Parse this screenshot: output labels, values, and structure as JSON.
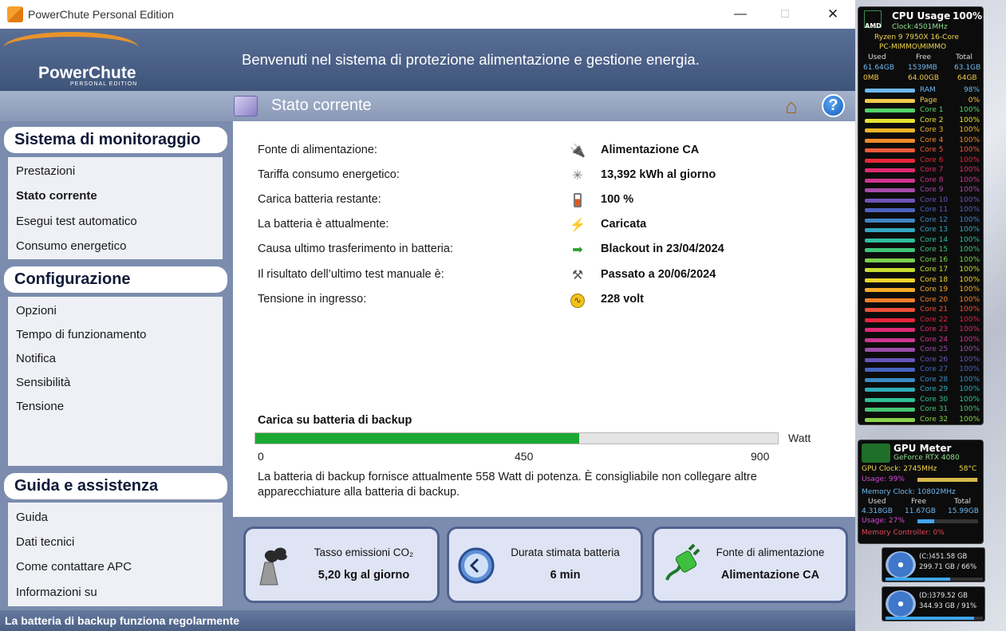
{
  "window": {
    "title": "PowerChute Personal Edition",
    "minimize": "—",
    "maximize": "☐",
    "close": "✕"
  },
  "header": {
    "logo": "PowerChute",
    "logo_sub": "PERSONAL EDITION",
    "welcome": "Benvenuti nel sistema di protezione alimentazione e gestione energia."
  },
  "page": {
    "title": "Stato corrente",
    "home_icon": "home-icon",
    "help_icon": "help-icon"
  },
  "sidebar": {
    "sections": [
      {
        "title": "Sistema di monitoraggio",
        "items": [
          "Prestazioni",
          "Stato corrente",
          "Esegui test automatico",
          "Consumo energetico"
        ]
      },
      {
        "title": "Configurazione",
        "items": [
          "Opzioni",
          "Tempo di funzionamento",
          "Notifica",
          "Sensibilità",
          "Tensione"
        ]
      },
      {
        "title": "Guida e assistenza",
        "items": [
          "Guida",
          "Dati tecnici",
          "Come contattare APC",
          "Informazioni su"
        ]
      }
    ],
    "active_item": "Stato corrente"
  },
  "status": {
    "rows": [
      {
        "label": "Fonte di alimentazione:",
        "value": "Alimentazione CA",
        "icon": "plug-icon"
      },
      {
        "label": "Tariffa consumo energetico:",
        "value": "13,392 kWh al giorno",
        "icon": "power-tower-icon"
      },
      {
        "label": "Carica batteria restante:",
        "value": "100 %",
        "icon": "battery-icon"
      },
      {
        "label": "La batteria è attualmente:",
        "value": "Caricata",
        "icon": "lightning-icon"
      },
      {
        "label": "Causa ultimo trasferimento in batteria:",
        "value": "Blackout in 23/04/2024",
        "icon": "transfer-icon"
      },
      {
        "label": "Il risultato dell’ultimo test manuale è:",
        "value": "Passato a 20/06/2024",
        "icon": "wrench-icon"
      },
      {
        "label": "Tensione in ingresso:",
        "value": "228 volt",
        "icon": "voltage-icon"
      }
    ]
  },
  "load": {
    "title": "Carica su batteria di backup",
    "unit": "Watt",
    "value": 558,
    "max": 900,
    "ticks": [
      "0",
      "450",
      "900"
    ],
    "note": "La batteria di backup fornisce attualmente 558 Watt di potenza. È consigliabile non collegare altre apparecchiature alla batteria di backup."
  },
  "cards": [
    {
      "label": "Tasso emissioni CO₂",
      "value": "5,20 kg al giorno",
      "icon": "factory-smoke-icon"
    },
    {
      "label": "Durata stimata batteria",
      "value": "6 min",
      "icon": "clock-icon"
    },
    {
      "label": "Fonte di alimentazione",
      "value": "Alimentazione CA",
      "icon": "plug-icon"
    }
  ],
  "statusbar": {
    "text": "La batteria di backup funziona regolarmente"
  },
  "cpu_meter": {
    "title": "CPU Usage",
    "usage": "100%",
    "brand": "AMD",
    "clock": "Clock:4501MHz",
    "model": "Ryzen 9 7950X 16-Core",
    "host": "PC-MIMMO\\MIMMO",
    "mem_headers": [
      "Used",
      "Free",
      "Total"
    ],
    "ram_values": [
      "61.64GB",
      "1539MB",
      "63.1GB"
    ],
    "page_values": [
      "0MB",
      "64.00GB",
      "64GB"
    ],
    "ram": {
      "name": "RAM",
      "pct": "98%"
    },
    "page": {
      "name": "Page",
      "pct": "0%"
    },
    "cores": [
      {
        "name": "Core 1",
        "pct": "100%",
        "color": "#52d46a"
      },
      {
        "name": "Core 2",
        "pct": "100%",
        "color": "#e6e231"
      },
      {
        "name": "Core 3",
        "pct": "100%",
        "color": "#f2b527"
      },
      {
        "name": "Core 4",
        "pct": "100%",
        "color": "#f08a2a"
      },
      {
        "name": "Core 5",
        "pct": "100%",
        "color": "#ef5a3a"
      },
      {
        "name": "Core 6",
        "pct": "100%",
        "color": "#e8283a"
      },
      {
        "name": "Core 7",
        "pct": "100%",
        "color": "#e02a72"
      },
      {
        "name": "Core 8",
        "pct": "100%",
        "color": "#d0348e"
      },
      {
        "name": "Core 9",
        "pct": "100%",
        "color": "#a64aa8"
      },
      {
        "name": "Core 10",
        "pct": "100%",
        "color": "#6f53b8"
      },
      {
        "name": "Core 11",
        "pct": "100%",
        "color": "#4d62c0"
      },
      {
        "name": "Core 12",
        "pct": "100%",
        "color": "#3f86c4"
      },
      {
        "name": "Core 13",
        "pct": "100%",
        "color": "#33a7bf"
      },
      {
        "name": "Core 14",
        "pct": "100%",
        "color": "#2fbf9e"
      },
      {
        "name": "Core 15",
        "pct": "100%",
        "color": "#40c57a"
      },
      {
        "name": "Core 16",
        "pct": "100%",
        "color": "#7bd14e"
      },
      {
        "name": "Core 17",
        "pct": "100%",
        "color": "#c7dd32"
      },
      {
        "name": "Core 18",
        "pct": "100%",
        "color": "#efd52b"
      },
      {
        "name": "Core 19",
        "pct": "100%",
        "color": "#f5ac28"
      },
      {
        "name": "Core 20",
        "pct": "100%",
        "color": "#f2802b"
      },
      {
        "name": "Core 21",
        "pct": "100%",
        "color": "#ed4f3a"
      },
      {
        "name": "Core 22",
        "pct": "100%",
        "color": "#e6253d"
      },
      {
        "name": "Core 23",
        "pct": "100%",
        "color": "#df2a75"
      },
      {
        "name": "Core 24",
        "pct": "100%",
        "color": "#cc3791"
      },
      {
        "name": "Core 25",
        "pct": "100%",
        "color": "#9c4ca9"
      },
      {
        "name": "Core 26",
        "pct": "100%",
        "color": "#6655b9"
      },
      {
        "name": "Core 27",
        "pct": "100%",
        "color": "#4766c1"
      },
      {
        "name": "Core 28",
        "pct": "100%",
        "color": "#3a8bc4"
      },
      {
        "name": "Core 29",
        "pct": "100%",
        "color": "#30acbc"
      },
      {
        "name": "Core 30",
        "pct": "100%",
        "color": "#2fc098"
      },
      {
        "name": "Core 31",
        "pct": "100%",
        "color": "#45c674"
      },
      {
        "name": "Core 32",
        "pct": "100%",
        "color": "#88d34a"
      }
    ]
  },
  "gpu_meter": {
    "title": "GPU Meter",
    "model": "GeForce RTX 4080",
    "clock": "GPU Clock: 2745MHz",
    "temp": "58°C",
    "usage": "Usage: 99%",
    "usage_value": 0.99,
    "mem_clock": "Memory Clock: 10802MHz",
    "mem_headers": [
      "Used",
      "Free",
      "Total"
    ],
    "mem_values": [
      "4.318GB",
      "11.67GB",
      "15.99GB"
    ],
    "mem_usage": "Usage: 27%",
    "mem_usage_value": 0.27,
    "mem_controller": "Memory Controller: 0%"
  },
  "drives": [
    {
      "line1": "(C:)451.58 GB",
      "line2": "299.71 GB / 66%",
      "used": 0.66
    },
    {
      "line1": "(D:)379.52 GB",
      "line2": "344.93 GB / 91%",
      "used": 0.91
    }
  ]
}
